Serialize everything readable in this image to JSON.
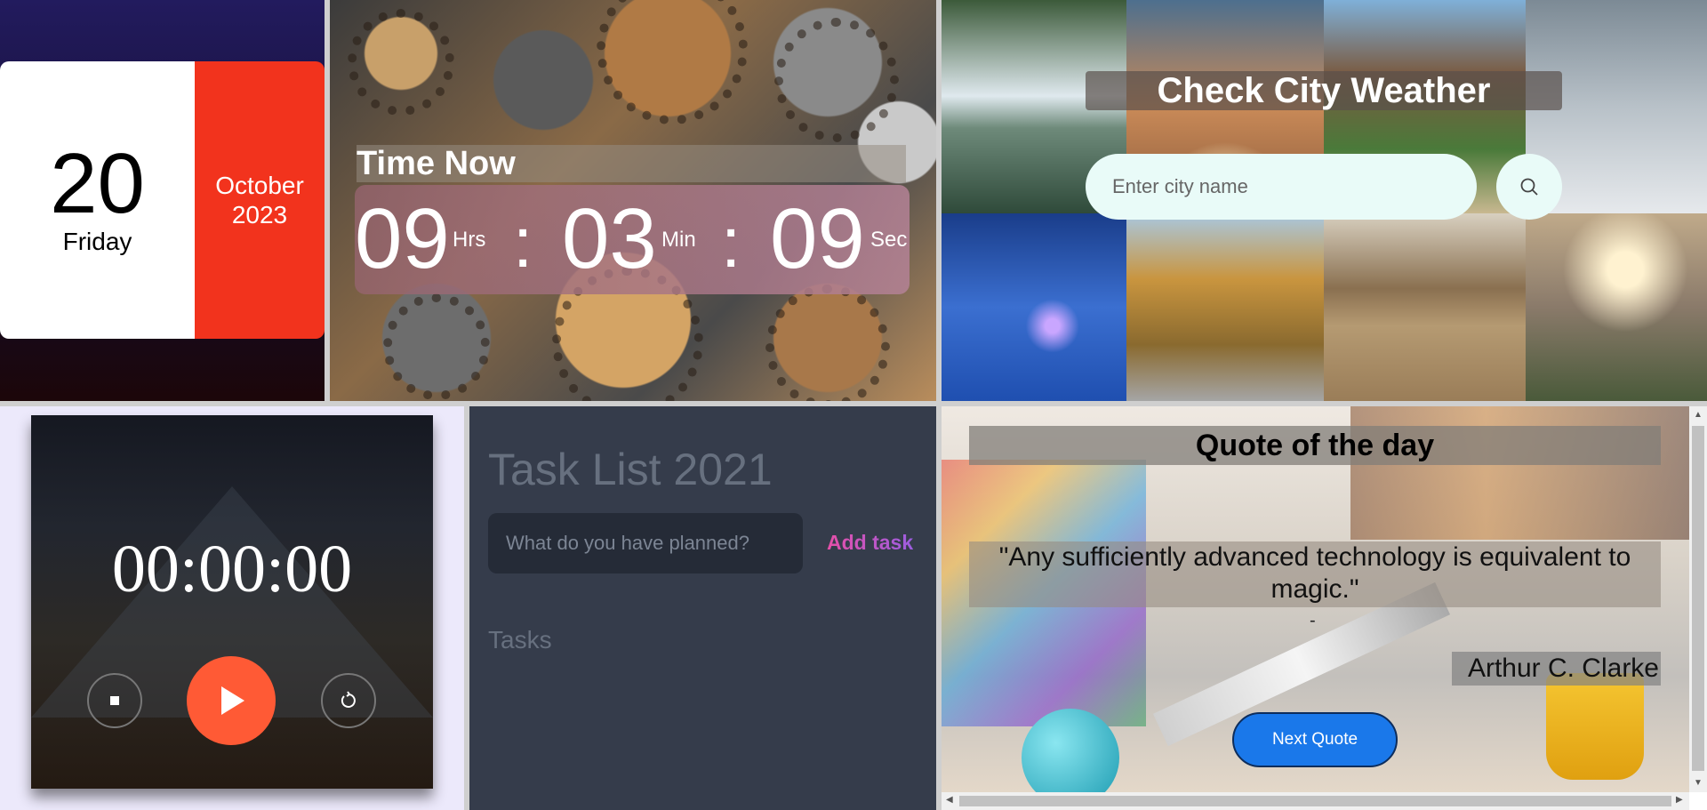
{
  "calendar": {
    "day": "20",
    "weekday": "Friday",
    "month": "October",
    "year": "2023"
  },
  "clock": {
    "title": "Time Now",
    "hours": "09",
    "hours_unit": "Hrs",
    "minutes": "03",
    "minutes_unit": "Min",
    "seconds": "09",
    "seconds_unit": "Sec",
    "separator": ":"
  },
  "weather": {
    "title": "Check City Weather",
    "placeholder": "Enter city name"
  },
  "timer": {
    "display": "00:00:00"
  },
  "tasks": {
    "title": "Task List 2021",
    "placeholder": "What do you have planned?",
    "add_label": "Add task",
    "list_heading": "Tasks"
  },
  "quote": {
    "title": "Quote of the day",
    "text": "\"Any sufficiently advanced technology is equivalent to magic.\"",
    "dash": "-",
    "author": "Arthur C. Clarke",
    "next_label": "Next Quote"
  },
  "colors": {
    "calendar_accent": "#f2331d",
    "play_button": "#ff5a35",
    "next_button": "#1a78ea",
    "task_panel": "#353c4b"
  }
}
